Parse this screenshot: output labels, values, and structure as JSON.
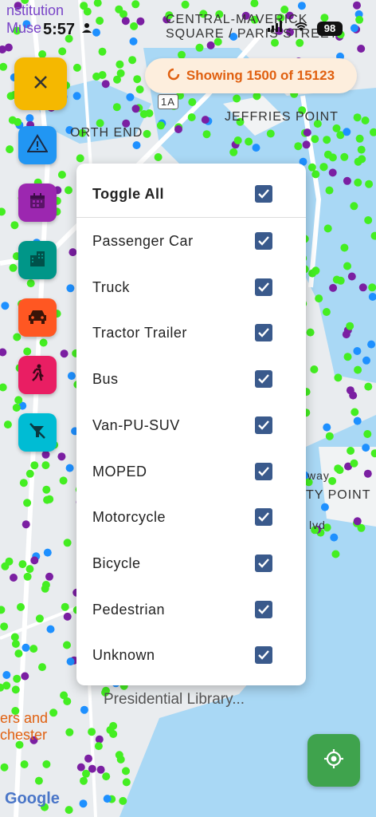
{
  "status_bar": {
    "time": "5:57",
    "battery": "98"
  },
  "map": {
    "labels": {
      "museum_line1": "nstitution",
      "museum_line2": "Muse",
      "central_square_1": "CENTRAL-MAVERICK",
      "central_square_2": "SQUARE / PARIS STREET",
      "jeffries": "JEFFRIES POINT",
      "north_end": "ORTH END",
      "route": "1A",
      "library": "Presidential Library...",
      "chester_1": "ers and",
      "chester_2": "chester",
      "point": "TY POINT",
      "way": "way",
      "blvd": "lvd"
    },
    "attribution": "Google"
  },
  "counter": {
    "text": "Showing 1500 of 15123"
  },
  "filter_panel": {
    "toggle_all": "Toggle All",
    "items": [
      {
        "label": "Passenger Car",
        "checked": true
      },
      {
        "label": "Truck",
        "checked": true
      },
      {
        "label": "Tractor Trailer",
        "checked": true
      },
      {
        "label": "Bus",
        "checked": true
      },
      {
        "label": "Van-PU-SUV",
        "checked": true
      },
      {
        "label": "MOPED",
        "checked": true
      },
      {
        "label": "Motorcycle",
        "checked": true
      },
      {
        "label": "Bicycle",
        "checked": true
      },
      {
        "label": "Pedestrian",
        "checked": true
      },
      {
        "label": "Unknown",
        "checked": true
      }
    ]
  },
  "fab_buttons": [
    {
      "icon": "warning-icon",
      "color": "#2196f3"
    },
    {
      "icon": "calendar-icon",
      "color": "#9c27b0"
    },
    {
      "icon": "building-icon",
      "color": "#009688"
    },
    {
      "icon": "car-icon",
      "color": "#ff5722"
    },
    {
      "icon": "pedestrian-icon",
      "color": "#e91e63"
    },
    {
      "icon": "no-bike-icon",
      "color": "#00bcd4"
    }
  ],
  "colors": {
    "close_fab": "#f5b800",
    "locate_fab": "#3fa34d",
    "checkbox": "#3a5a8c",
    "counter_text": "#e06010"
  }
}
